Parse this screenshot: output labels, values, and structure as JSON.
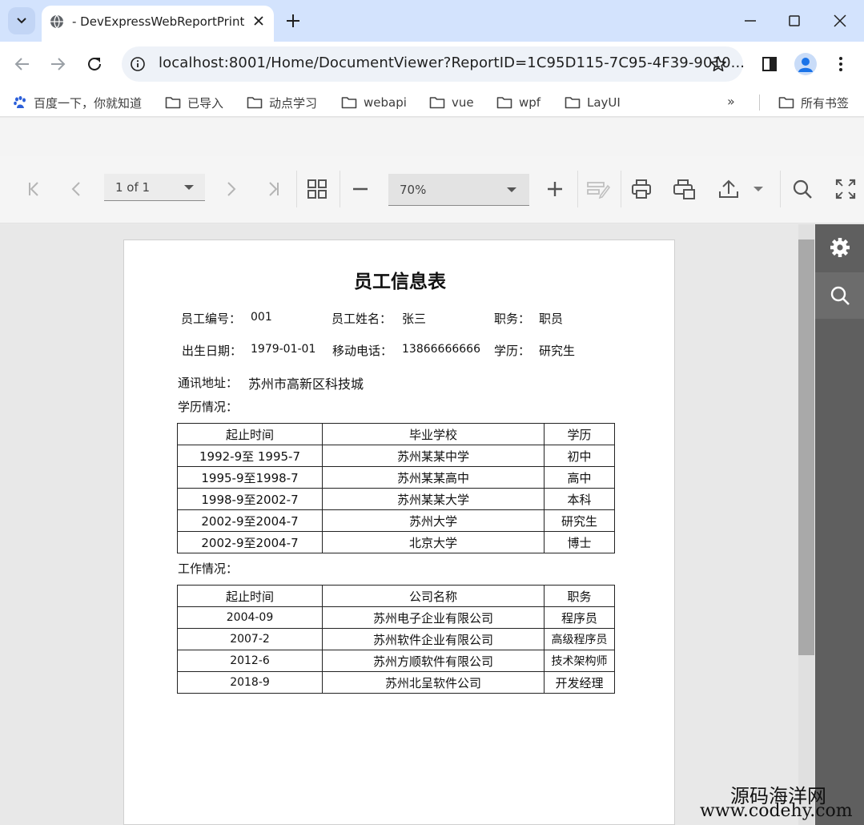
{
  "browser": {
    "tab_title": "- DevExpressWebReportPrint",
    "url": "localhost:8001/Home/DocumentViewer?ReportID=1C95D115-7C95-4F39-9010..."
  },
  "bookmarks": [
    {
      "label": "百度一下，你就知道",
      "icon": "baidu-paw-icon"
    },
    {
      "label": "已导入",
      "icon": "folder-icon"
    },
    {
      "label": "动点学习",
      "icon": "folder-icon"
    },
    {
      "label": "webapi",
      "icon": "folder-icon"
    },
    {
      "label": "vue",
      "icon": "folder-icon"
    },
    {
      "label": "wpf",
      "icon": "folder-icon"
    },
    {
      "label": "LayUI",
      "icon": "folder-icon"
    }
  ],
  "bookmarks_more": "»",
  "all_bookmarks_label": "所有书签",
  "viewer": {
    "page_value": "1 of 1",
    "zoom_value": "70%"
  },
  "report": {
    "title": "员工信息表",
    "fields": {
      "emp_no_label": "员工编号：",
      "emp_no": "001",
      "emp_name_label": "员工姓名：",
      "emp_name": "张三",
      "position_label": "职务：",
      "position": "职员",
      "birth_label": "出生日期：",
      "birth": "1979-01-01",
      "phone_label": "移动电话：",
      "phone": "13866666666",
      "degree_label": "学历：",
      "degree": "研究生",
      "address_label": "通讯地址：",
      "address": "苏州市高新区科技城"
    },
    "education_heading": "学历情况：",
    "education_table": {
      "headers": [
        "起止时间",
        "毕业学校",
        "学历"
      ],
      "rows": [
        [
          "1992-9至 1995-7",
          "苏州某某中学",
          "初中"
        ],
        [
          "1995-9至1998-7",
          "苏州某某高中",
          "高中"
        ],
        [
          "1998-9至2002-7",
          "苏州某某大学",
          "本科"
        ],
        [
          "2002-9至2004-7",
          "苏州大学",
          "研究生"
        ],
        [
          "2002-9至2004-7",
          "北京大学",
          "博士"
        ]
      ]
    },
    "work_heading": "工作情况：",
    "work_table": {
      "headers": [
        "起止时间",
        "公司名称",
        "职务"
      ],
      "rows": [
        [
          "2004-09",
          "苏州电子企业有限公司",
          "程序员"
        ],
        [
          "2007-2",
          "苏州软件企业有限公司",
          "高级程序员"
        ],
        [
          "2012-6",
          "苏州方顺软件有限公司",
          "技术架构师"
        ],
        [
          "2018-9",
          "苏州北呈软件公司",
          "开发经理"
        ]
      ]
    }
  },
  "watermark": {
    "line1": "源码海洋网",
    "line2": "www.codehy.com"
  }
}
